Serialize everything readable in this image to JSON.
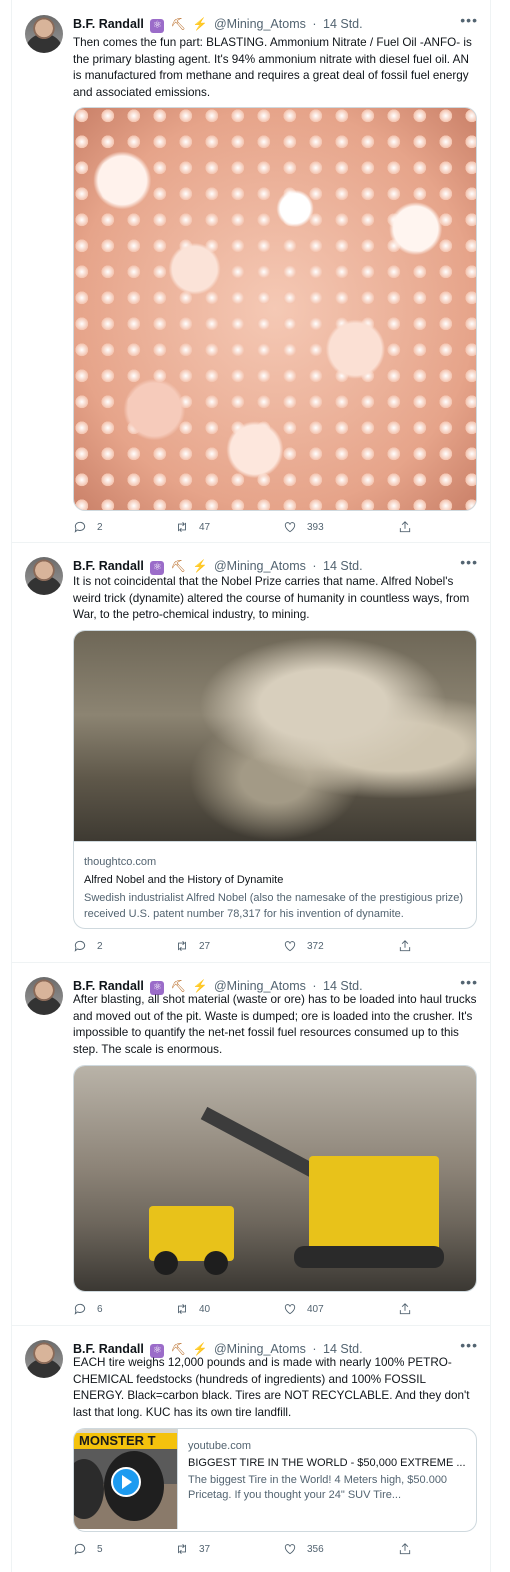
{
  "author": {
    "name": "B.F. Randall",
    "handle": "@Mining_Atoms",
    "time": "14 Std.",
    "badges": [
      "atom-emoji",
      "pick-emoji",
      "bolt-emoji"
    ]
  },
  "tweets": [
    {
      "text": "Then comes the fun part: BLASTING. Ammonium Nitrate / Fuel Oil -ANFO- is the primary blasting agent. It's 94% ammonium nitrate with diesel fuel oil. AN is manufactured from methane and requires a great deal of fossil fuel energy and associated emissions.",
      "counts": {
        "reply": "2",
        "retweet": "47",
        "like": "393"
      }
    },
    {
      "text": "It is not coincidental that the Nobel Prize carries that name. Alfred Nobel's weird trick (dynamite) altered the course of humanity in countless ways, from War, to the petro-chemical industry, to mining.",
      "card": {
        "domain": "thoughtco.com",
        "title": "Alfred Nobel and the History of Dynamite",
        "description": "Swedish industrialist Alfred Nobel (also the namesake of the prestigious prize) received U.S. patent number 78,317 for his invention of dynamite."
      },
      "counts": {
        "reply": "2",
        "retweet": "27",
        "like": "372"
      }
    },
    {
      "text": "After blasting, all shot material (waste or ore) has to be loaded into haul trucks and moved out of the pit. Waste is dumped; ore is loaded into the crusher. It's impossible to quantify the net-net fossil fuel resources consumed up to this step. The scale is enormous.",
      "counts": {
        "reply": "6",
        "retweet": "40",
        "like": "407"
      }
    },
    {
      "text": "EACH tire weighs 12,000 pounds and is made with nearly 100% PETRO-CHEMICAL feedstocks (hundreds of ingredients) and 100% FOSSIL ENERGY. Black=carbon black. Tires are NOT RECYCLABLE. And they don't last that long. KUC has its own tire landfill.",
      "card": {
        "thumb_banner": "MONSTER T",
        "domain": "youtube.com",
        "title": "BIGGEST TIRE IN THE WORLD - $50,000 EXTREME ...",
        "description": "The biggest Tire in the World! 4 Meters high, $50.000 Pricetag. If you thought your 24\" SUV Tire..."
      },
      "counts": {
        "reply": "5",
        "retweet": "37",
        "like": "356"
      }
    }
  ]
}
